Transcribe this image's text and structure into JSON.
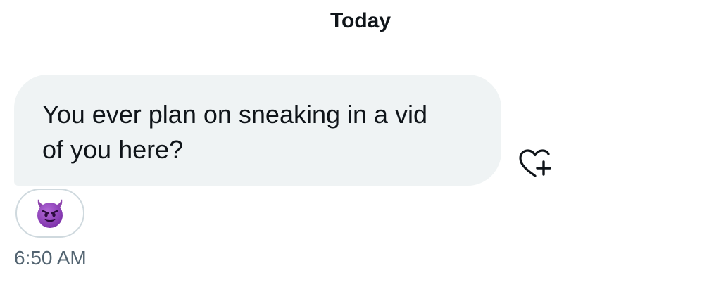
{
  "conversation": {
    "date_separator": "Today"
  },
  "message": {
    "text_line_1": "You ever plan on sneaking in a vid",
    "text_line_2": "of you here?",
    "timestamp": "6:50 AM",
    "reaction": {
      "emoji": "😈",
      "icon": "smiling-devil-icon"
    },
    "add_reaction_icon": "heart-plus-icon"
  },
  "colors": {
    "bubble_background": "#eff3f4",
    "text_primary": "#0f1419",
    "text_secondary": "#536471",
    "pill_border": "#cfd9de",
    "devil_purple": "#8e44ad"
  }
}
